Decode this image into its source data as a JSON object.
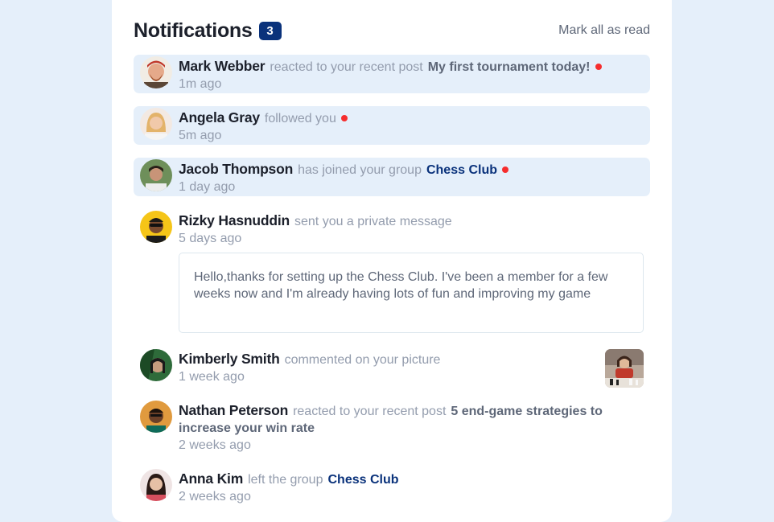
{
  "header": {
    "title": "Notifications",
    "unread_count": "3",
    "mark_all_label": "Mark all as read"
  },
  "notifications": [
    {
      "name": "Mark Webber",
      "action": "reacted to your recent post",
      "target": "My first tournament today!",
      "target_type": "post",
      "time": "1m ago",
      "unread": true,
      "avatar_icon": "avatar-mark-webber"
    },
    {
      "name": "Angela Gray",
      "action": "followed you",
      "target": "",
      "target_type": "none",
      "time": "5m ago",
      "unread": true,
      "avatar_icon": "avatar-angela-gray"
    },
    {
      "name": "Jacob Thompson",
      "action": "has joined your group",
      "target": "Chess Club",
      "target_type": "group",
      "time": "1 day ago",
      "unread": true,
      "avatar_icon": "avatar-jacob-thompson"
    },
    {
      "name": "Rizky Hasnuddin",
      "action": "sent you a private message",
      "target": "",
      "target_type": "none",
      "time": "5 days ago",
      "unread": false,
      "message": "Hello,thanks for setting up the Chess Club. I've been a member for a few weeks now and I'm already having lots of fun and improving my game",
      "avatar_icon": "avatar-rizky-hasnuddin"
    },
    {
      "name": "Kimberly Smith",
      "action": "commented on your picture",
      "target": "",
      "target_type": "none",
      "time": "1 week ago",
      "unread": false,
      "picture_icon": "chess-picture-thumbnail",
      "avatar_icon": "avatar-kimberly-smith"
    },
    {
      "name": "Nathan Peterson",
      "action": "reacted to your recent post",
      "target": "5 end-game strategies to increase your win rate",
      "target_type": "post",
      "time": "2 weeks ago",
      "unread": false,
      "avatar_icon": "avatar-nathan-peterson"
    },
    {
      "name": "Anna Kim",
      "action": "left the group",
      "target": "Chess Club",
      "target_type": "group",
      "time": "2 weeks ago",
      "unread": false,
      "avatar_icon": "avatar-anna-kim"
    }
  ],
  "colors": {
    "page_bg": "#e5effa",
    "card_bg": "#ffffff",
    "unread_bg": "#e5effa",
    "badge_bg": "#0a327b",
    "group_link": "#0a327b",
    "unread_dot": "#f62d2d",
    "muted_text": "#939cad",
    "dark_text": "#1c202b"
  }
}
